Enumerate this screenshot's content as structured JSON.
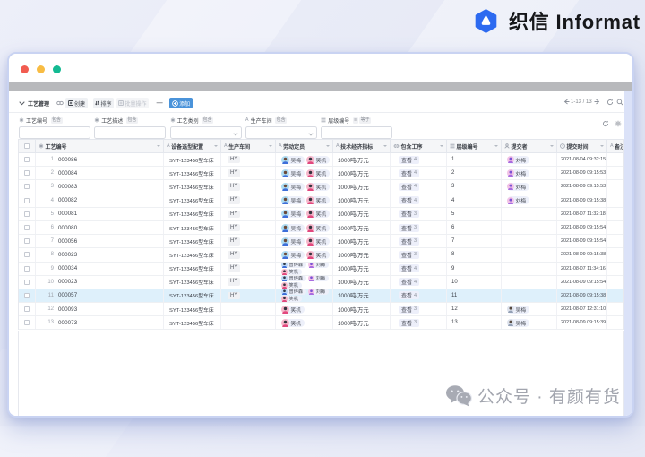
{
  "brand": {
    "logo_cn": "织信",
    "logo_en": "Informat",
    "logo_color": "#2e6ef0"
  },
  "watermark": {
    "text": "公众号 · 有颜有货"
  },
  "window": {
    "traffic_lights": [
      {
        "name": "close",
        "color": "#f25c50"
      },
      {
        "name": "minimize",
        "color": "#f8bc43"
      },
      {
        "name": "zoom",
        "color": "#13ba92"
      }
    ]
  },
  "toolbar": {
    "title": "工艺管理",
    "create_label": "创建",
    "sort_label": "排序",
    "batch_label": "批量操作",
    "more_label": "—",
    "add_label": "添加",
    "pagination": "1-13 / 13",
    "accent_color": "#4a93da"
  },
  "filters": [
    {
      "icon": "asterisk",
      "field": "工艺编号",
      "badges": [
        "包含"
      ],
      "kind": "text"
    },
    {
      "icon": "asterisk",
      "field": "工艺描述",
      "badges": [
        "包含"
      ],
      "kind": "text"
    },
    {
      "icon": "asterisk",
      "field": "工艺类别",
      "badges": [
        "包含"
      ],
      "kind": "select"
    },
    {
      "icon": "A",
      "field": "生产车间",
      "badges": [
        "包含"
      ],
      "kind": "select"
    },
    {
      "icon": "list",
      "field": "层级编号",
      "badges": [
        "≡",
        "等于"
      ],
      "kind": "text"
    }
  ],
  "users": {
    "wumei": {
      "name": "吴梅",
      "bg": "#aedcf2",
      "hair": "#6b4a39",
      "shirt": "#3e6fd9"
    },
    "xiaoji": {
      "name": "笑机",
      "bg": "#f6b8cb",
      "hair": "#35323e",
      "shirt": "#e2487e"
    },
    "zengyesen": {
      "name": "曾烨森",
      "bg": "#bdd8f7",
      "hair": "#2f3a4a",
      "shirt": "#3e6fd9"
    },
    "liumei": {
      "name": "刘梅",
      "bg": "#f3c3e6",
      "hair": "#7b52d4",
      "shirt": "#a86be0"
    },
    "wumei_gray": {
      "name": "吴梅",
      "bg": "#dde2ec",
      "hair": "#56493f",
      "shirt": "#93a0b5"
    }
  },
  "table": {
    "view_label": "查看",
    "columns": [
      {
        "icon": "checkbox",
        "label": ""
      },
      {
        "icon": "asterisk",
        "label": "工艺编号"
      },
      {
        "icon": "A",
        "label": "设备选型配置"
      },
      {
        "icon": "A",
        "label": "生产车间"
      },
      {
        "icon": "A",
        "label": "劳动定员"
      },
      {
        "icon": "A",
        "label": "技术经济指标"
      },
      {
        "icon": "link",
        "label": "包含工序"
      },
      {
        "icon": "list",
        "label": "层级编号"
      },
      {
        "icon": "person",
        "label": "提交者"
      },
      {
        "icon": "clock",
        "label": "提交时间"
      },
      {
        "icon": "A",
        "label": "备注"
      }
    ],
    "rows": [
      {
        "num": 1,
        "code": "000086",
        "device": "SYT-123456型车床",
        "workshop": "HY",
        "staff": [
          [
            "wumei",
            "xiaoji"
          ]
        ],
        "metric": "1000吨/万元",
        "ops": 4,
        "level": 1,
        "submitter": "liumei",
        "time": "2021-08-04 09:32:15",
        "highlight": false
      },
      {
        "num": 2,
        "code": "000084",
        "device": "SYT-123456型车床",
        "workshop": "HY",
        "staff": [
          [
            "wumei",
            "xiaoji"
          ]
        ],
        "metric": "1000吨/万元",
        "ops": 4,
        "level": 2,
        "submitter": "liumei",
        "time": "2021-08-09 09:15:53",
        "highlight": false
      },
      {
        "num": 3,
        "code": "000083",
        "device": "SYT-123456型车床",
        "workshop": "HY",
        "staff": [
          [
            "wumei",
            "xiaoji"
          ]
        ],
        "metric": "1000吨/万元",
        "ops": 4,
        "level": 3,
        "submitter": "liumei",
        "time": "2021-08-09 09:15:53",
        "highlight": false
      },
      {
        "num": 4,
        "code": "000082",
        "device": "SYT-123456型车床",
        "workshop": "HY",
        "staff": [
          [
            "wumei",
            "xiaoji"
          ]
        ],
        "metric": "1000吨/万元",
        "ops": 4,
        "level": 4,
        "submitter": "liumei",
        "time": "2021-08-09 09:15:38",
        "highlight": false
      },
      {
        "num": 5,
        "code": "000081",
        "device": "SYT-123456型车床",
        "workshop": "HY",
        "staff": [
          [
            "wumei",
            "xiaoji"
          ]
        ],
        "metric": "1000吨/万元",
        "ops": 3,
        "level": 5,
        "submitter": null,
        "time": "2021-08-07 11:32:18",
        "highlight": false
      },
      {
        "num": 6,
        "code": "000080",
        "device": "SYT-123456型车床",
        "workshop": "HY",
        "staff": [
          [
            "wumei",
            "xiaoji"
          ]
        ],
        "metric": "1000吨/万元",
        "ops": 3,
        "level": 6,
        "submitter": null,
        "time": "2021-08-09 09:15:54",
        "highlight": false
      },
      {
        "num": 7,
        "code": "000056",
        "device": "SYT-123456型车床",
        "workshop": "HY",
        "staff": [
          [
            "wumei",
            "xiaoji"
          ]
        ],
        "metric": "1000吨/万元",
        "ops": 3,
        "level": 7,
        "submitter": null,
        "time": "2021-08-09 09:15:54",
        "highlight": false
      },
      {
        "num": 8,
        "code": "000023",
        "device": "SYT-123456型车床",
        "workshop": "HY",
        "staff": [
          [
            "wumei",
            "xiaoji"
          ]
        ],
        "metric": "1000吨/万元",
        "ops": 3,
        "level": 8,
        "submitter": null,
        "time": "2021-08-09 09:15:38",
        "highlight": false
      },
      {
        "num": 9,
        "code": "000034",
        "device": "SYT-123456型车床",
        "workshop": "HY",
        "staff": [
          [
            "zengyesen",
            "liumei"
          ],
          [
            "xiaoji"
          ]
        ],
        "metric": "1000吨/万元",
        "ops": 4,
        "level": 9,
        "submitter": null,
        "time": "2021-08-07 11:34:16",
        "highlight": false
      },
      {
        "num": 10,
        "code": "000023",
        "device": "SYT-123456型车床",
        "workshop": "HY",
        "staff": [
          [
            "zengyesen",
            "liumei"
          ],
          [
            "xiaoji"
          ]
        ],
        "metric": "1000吨/万元",
        "ops": 4,
        "level": 10,
        "submitter": null,
        "time": "2021-08-09 09:15:54",
        "highlight": false
      },
      {
        "num": 11,
        "code": "000057",
        "device": "SYT-123456型车床",
        "workshop": "HY",
        "staff": [
          [
            "zengyesen",
            "liumei"
          ],
          [
            "xiaoji"
          ]
        ],
        "metric": "1000吨/万元",
        "ops": 4,
        "level": 11,
        "submitter": null,
        "time": "2021-08-09 09:15:38",
        "highlight": true
      },
      {
        "num": 12,
        "code": "000093",
        "device": "SYT-123456型车床",
        "workshop": "",
        "staff": [
          [
            "xiaoji"
          ]
        ],
        "metric": "1000吨/万元",
        "ops": 3,
        "level": 12,
        "submitter": "wumei_gray",
        "time": "2021-08-07 12:31:10",
        "highlight": false
      },
      {
        "num": 13,
        "code": "000073",
        "device": "SYT-123456型车床",
        "workshop": "",
        "staff": [
          [
            "xiaoji"
          ]
        ],
        "metric": "1000吨/万元",
        "ops": 3,
        "level": 13,
        "submitter": "wumei_gray",
        "time": "2021-08-09 09:15:39",
        "highlight": false
      }
    ]
  }
}
